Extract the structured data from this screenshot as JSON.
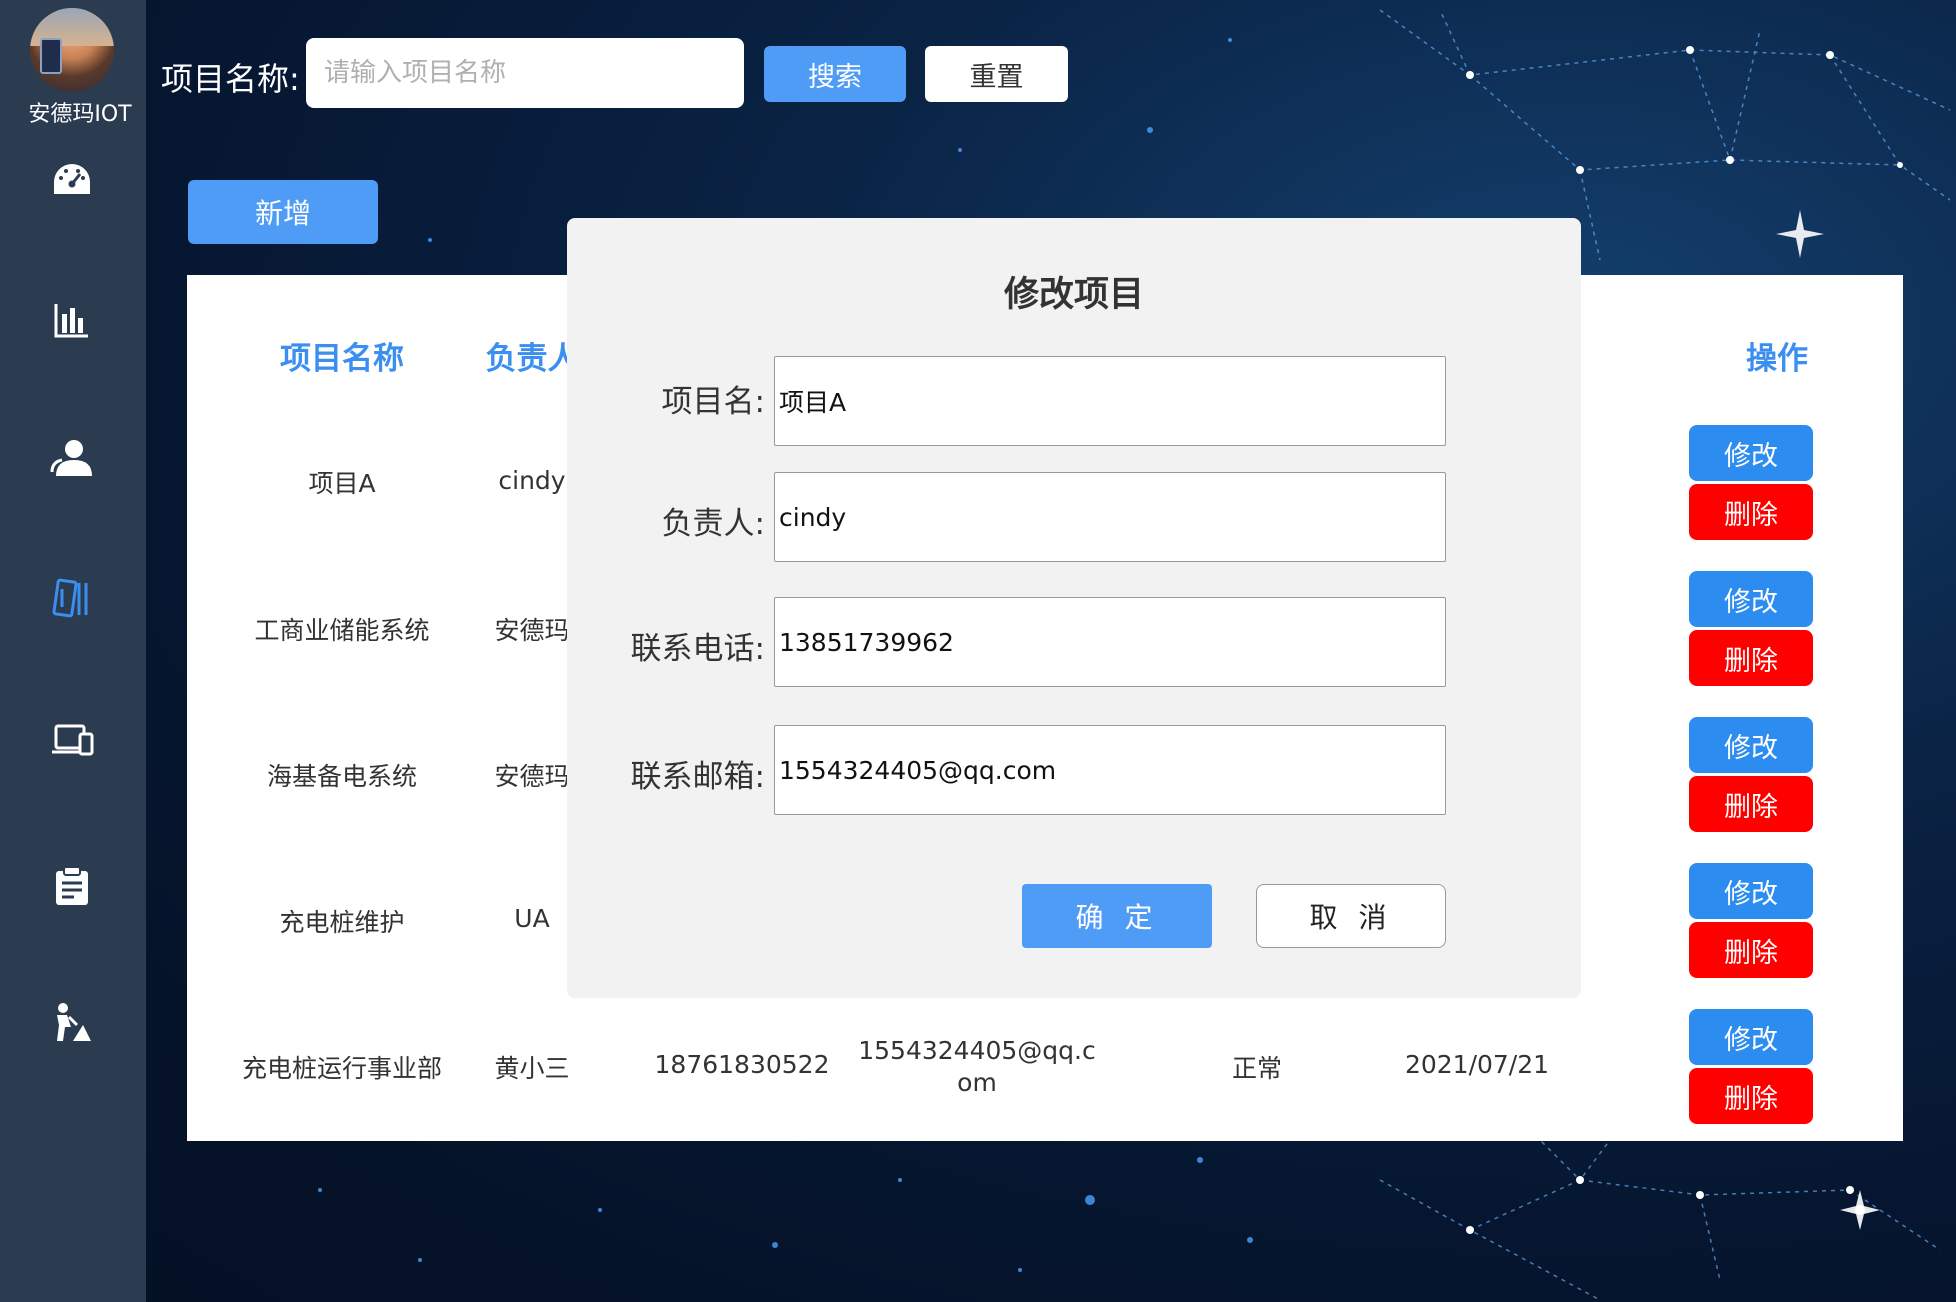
{
  "sidebar": {
    "brand": "安德玛IOT",
    "items": [
      {
        "icon": "dashboard-icon"
      },
      {
        "icon": "bar-chart-icon"
      },
      {
        "icon": "users-icon"
      },
      {
        "icon": "projects-icon",
        "active": true
      },
      {
        "icon": "devices-icon"
      },
      {
        "icon": "clipboard-icon"
      },
      {
        "icon": "maintenance-icon"
      }
    ]
  },
  "search": {
    "label": "项目名称:",
    "placeholder": "请输入项目名称",
    "search_label": "搜索",
    "reset_label": "重置"
  },
  "toolbar": {
    "add_label": "新增"
  },
  "table": {
    "headers": {
      "name": "项目名称",
      "owner": "负责人",
      "actions": "操作"
    },
    "rows": [
      {
        "name": "项目A",
        "owner": "cindy",
        "phone": "",
        "email": "",
        "status": "",
        "date": ""
      },
      {
        "name": "工商业储能系统",
        "owner": "安德玛",
        "phone": "",
        "email": "",
        "status": "",
        "date": ""
      },
      {
        "name": "海基备电系统",
        "owner": "安德玛",
        "phone": "",
        "email": "",
        "status": "",
        "date": ""
      },
      {
        "name": "充电桩维护",
        "owner": "UA",
        "phone": "",
        "email": "",
        "status": "",
        "date": ""
      },
      {
        "name": "充电桩运行事业部",
        "owner": "黄小三",
        "phone": "18761830522",
        "email": "1554324405@qq.com",
        "status": "正常",
        "date": "2021/07/21"
      }
    ],
    "edit_label": "修改",
    "delete_label": "删除"
  },
  "modal": {
    "title": "修改项目",
    "fields": {
      "name": {
        "label": "项目名:",
        "value": "项目A"
      },
      "owner": {
        "label": "负责人:",
        "value": "cindy"
      },
      "phone": {
        "label": "联系电话:",
        "value": "13851739962"
      },
      "email": {
        "label": "联系邮箱:",
        "value": "1554324405@qq.com"
      }
    },
    "ok_label": "确 定",
    "cancel_label": "取 消"
  },
  "colors": {
    "primary": "#4f9cf6",
    "header_text": "#3b8ff0",
    "edit_button": "#2d8cf0",
    "delete_button": "#ff0000",
    "sidebar": "#2b3b50",
    "active_icon": "#3b8ff0"
  }
}
